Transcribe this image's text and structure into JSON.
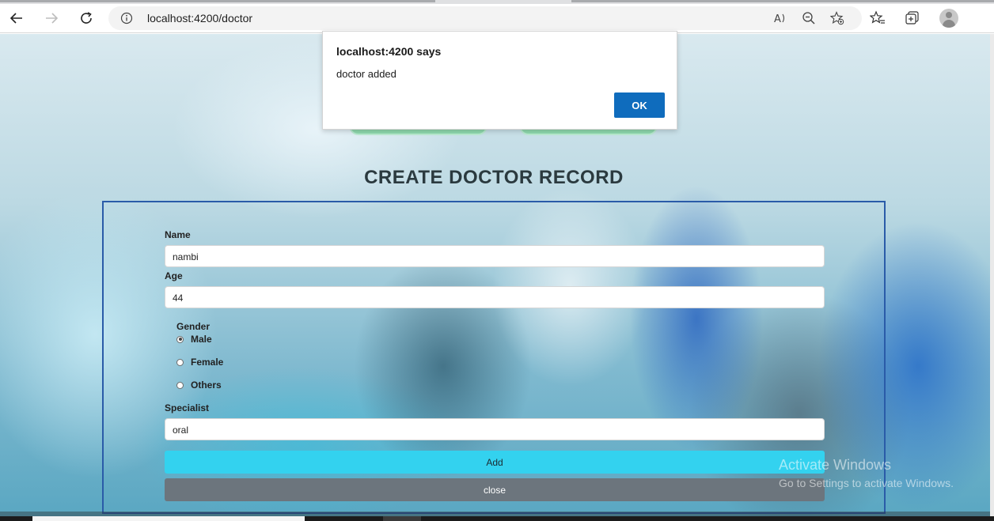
{
  "browser": {
    "url": "localhost:4200/doctor"
  },
  "page": {
    "heading": "CREATE DOCTOR RECORD",
    "form": {
      "name_label": "Name",
      "name_value": "nambi",
      "age_label": "Age",
      "age_value": "44",
      "gender_label": "Gender",
      "gender_options": [
        "Male",
        "Female",
        "Others"
      ],
      "gender_selected": "Male",
      "specialist_label": "Specialist",
      "specialist_value": "oral",
      "add_label": "Add",
      "close_label": "close"
    },
    "watermark": {
      "line1": "Activate Windows",
      "line2": "Go to Settings to activate Windows."
    }
  },
  "alert": {
    "title": "localhost:4200 says",
    "message": "doctor added",
    "ok_label": "OK"
  },
  "colors": {
    "add_button": "#33d2ef",
    "close_button": "#6c757d",
    "form_border": "#2a5ba8",
    "ok_button": "#0f6cbd"
  },
  "icons": [
    "back-icon",
    "forward-icon",
    "refresh-icon",
    "info-icon",
    "read-aloud-icon",
    "zoom-out-icon",
    "add-favorite-icon",
    "favorites-icon",
    "collections-icon",
    "profile-icon"
  ]
}
